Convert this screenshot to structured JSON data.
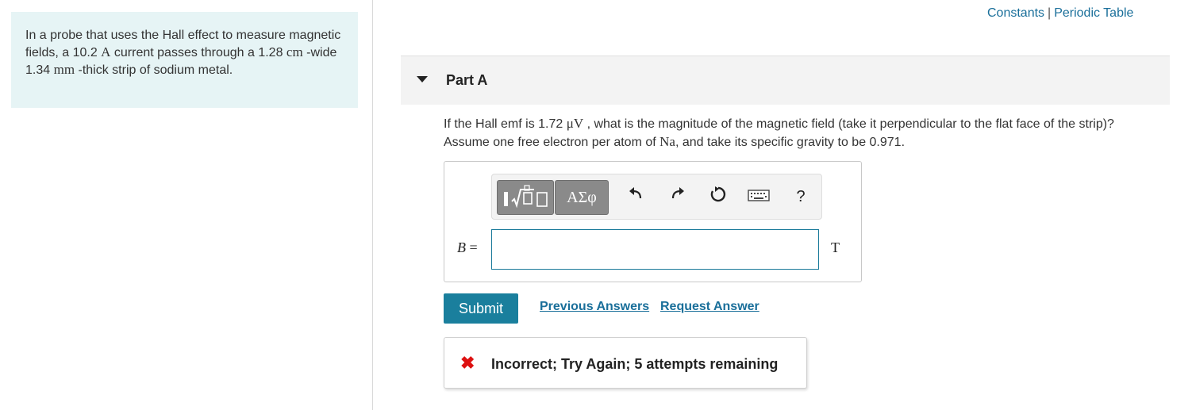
{
  "problem": {
    "intro": "In a probe that uses the Hall effect to measure magnetic fields, a 10.2 ",
    "current_unit": "A",
    "mid1": " current passes through a 1.28 ",
    "width_unit": "cm",
    "mid2": " -wide 1.34 ",
    "thick_unit": "mm",
    "end": " -thick strip of sodium metal."
  },
  "top_links": {
    "constants": "Constants",
    "separator": "|",
    "periodic_table": "Periodic Table"
  },
  "part": {
    "title": "Part A"
  },
  "question": {
    "text1": "If the Hall emf is 1.72 ",
    "emf_unit": "μV",
    "text2": " , what is the magnitude of the magnetic field (take it perpendicular to the flat face of the strip)? Assume one free electron per atom of ",
    "element": "Na",
    "text3": ", and take its specific gravity to be 0.971."
  },
  "toolbar": {
    "greek_label": "ΑΣφ",
    "undo_icon": "undo-icon",
    "redo_icon": "redo-icon",
    "reset_icon": "reset-icon",
    "keyboard_icon": "keyboard-icon",
    "help_label": "?"
  },
  "answer": {
    "variable": "B",
    "equals": "=",
    "value": "",
    "unit": "T"
  },
  "actions": {
    "submit_label": "Submit",
    "previous_answers": "Previous Answers",
    "request_answer": "Request Answer"
  },
  "feedback": {
    "message": "Incorrect; Try Again; 5 attempts remaining"
  },
  "colors": {
    "accent": "#1a7f9d",
    "link": "#1a6f9a",
    "error": "#dd1111",
    "problem_bg": "#e6f4f5"
  }
}
